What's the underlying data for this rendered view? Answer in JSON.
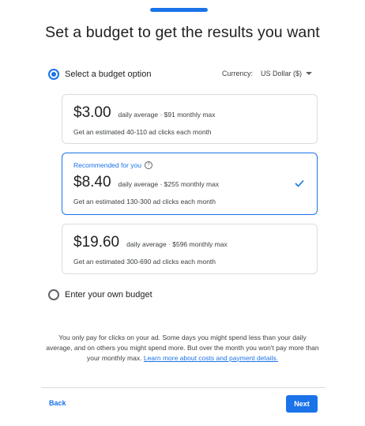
{
  "progress": {
    "fraction": 1.0,
    "color": "#1a73e8"
  },
  "title": "Set a budget to get the results you want",
  "budget_option": {
    "label": "Select a budget option",
    "selected": true
  },
  "currency": {
    "label": "Currency:",
    "value": "US Dollar ($)"
  },
  "options": [
    {
      "amount": "$3.00",
      "meta": "daily average · $91 monthly max",
      "clicks": "Get an estimated 40-110 ad clicks each month",
      "selected": false
    },
    {
      "recommended": "Recommended for you",
      "amount": "$8.40",
      "meta": "daily average · $255 monthly max",
      "clicks": "Get an estimated 130-300 ad clicks each month",
      "selected": true
    },
    {
      "amount": "$19.60",
      "meta": "daily average · $596 monthly max",
      "clicks": "Get an estimated 300-690 ad clicks each month",
      "selected": false
    }
  ],
  "own_budget": {
    "label": "Enter your own budget",
    "selected": false
  },
  "footnote": {
    "text": "You only pay for clicks on your ad. Some days you might spend less than your daily average, and on others you might spend more. But over the month you won't pay more than your monthly max. ",
    "link": "Learn more about costs and payment details."
  },
  "nav": {
    "back": "Back",
    "next": "Next"
  },
  "colors": {
    "accent": "#1a73e8",
    "border": "#dadce0",
    "text": "#202124"
  }
}
